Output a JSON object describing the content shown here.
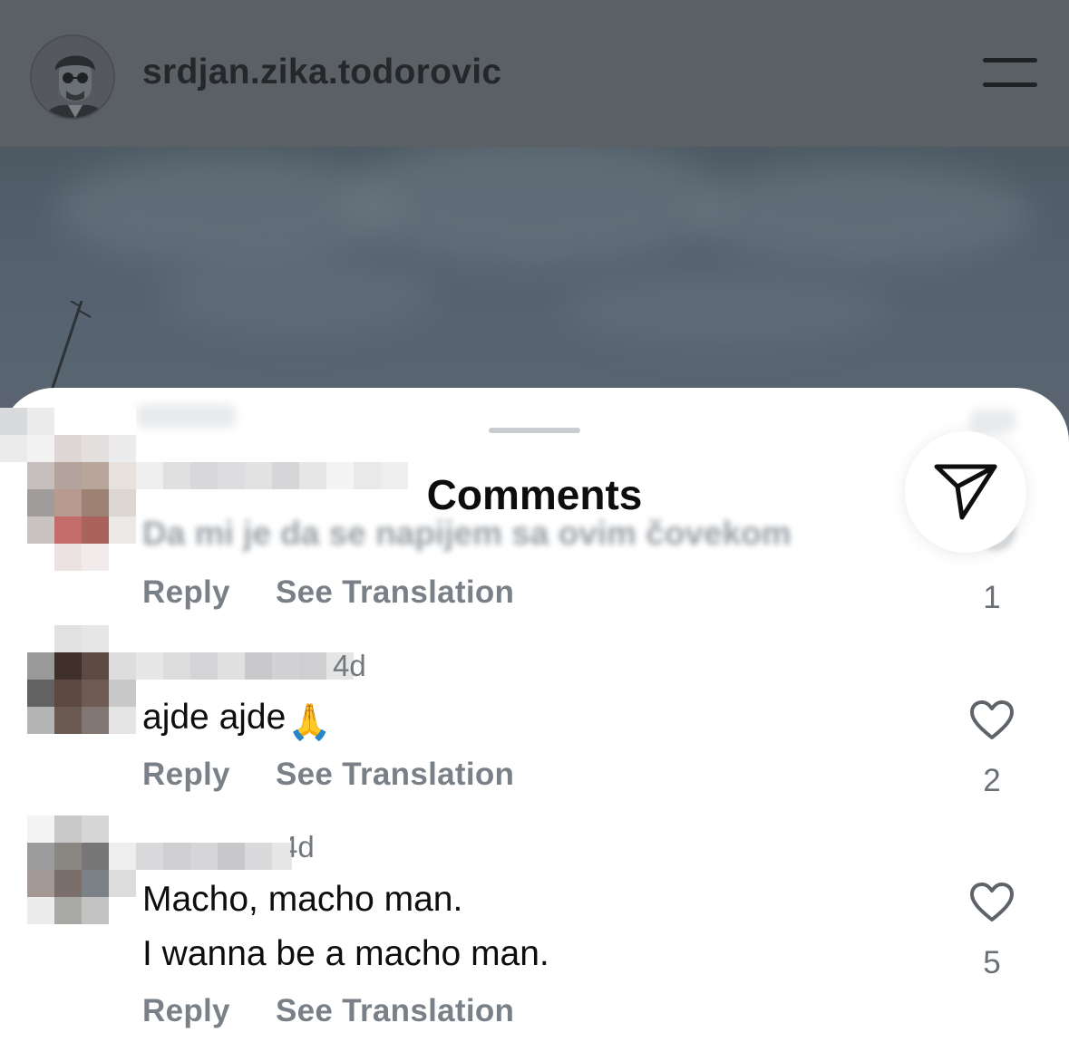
{
  "header": {
    "username": "srdjan.zika.todorovic",
    "avatar_icon": "profile-portrait-icon",
    "menu_icon": "hamburger-menu-icon"
  },
  "sheet": {
    "title": "Comments",
    "share_icon": "paper-plane-icon"
  },
  "comments": [
    {
      "time": "",
      "text": "Da mi je da se napijem sa ovim čovekom",
      "reply_label": "Reply",
      "translate_label": "See Translation",
      "likes": "1"
    },
    {
      "time": "4d",
      "text": "ajde ajde",
      "emoji": "🙏",
      "reply_label": "Reply",
      "translate_label": "See Translation",
      "likes": "2"
    },
    {
      "time": "4d",
      "text_line1": "Macho, macho man.",
      "text_line2": "I wanna be a macho man.",
      "reply_label": "Reply",
      "translate_label": "See Translation",
      "likes": "5"
    }
  ],
  "colors": {
    "header_bg": "#5b6065",
    "sheet_bg": "#ffffff",
    "action_text": "#7a8087",
    "heart_outline": "#5e6369"
  }
}
